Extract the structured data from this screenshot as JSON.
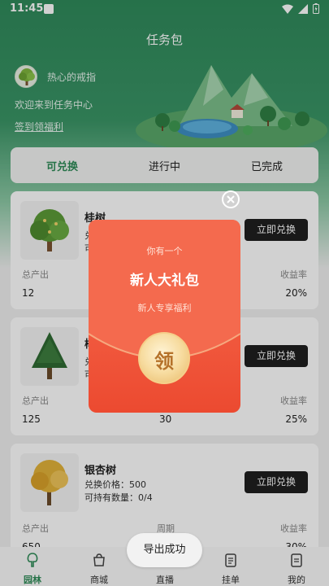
{
  "status_bar": {
    "time": "11:45"
  },
  "header": {
    "title": "任务包"
  },
  "user": {
    "name": "热心的戒指"
  },
  "welcome": {
    "text": "欢迎来到任务中心",
    "signin_link": "签到领福利"
  },
  "tabs": [
    {
      "label": "可兑换",
      "active": true
    },
    {
      "label": "进行中",
      "active": false
    },
    {
      "label": "已完成",
      "active": false
    }
  ],
  "cards": [
    {
      "name": "桂树",
      "line1": "兑",
      "line2": "可",
      "button": "立即兑换",
      "stat1_label": "总产出",
      "stat1_value": "12",
      "stat3_label": "收益率",
      "stat3_value": "20%"
    },
    {
      "name": "榉",
      "line1": "兑",
      "line2": "可",
      "button": "立即兑换",
      "stat1_label": "总产出",
      "stat1_value": "125",
      "stat2_value": "30",
      "stat3_label": "收益率",
      "stat3_value": "25%"
    },
    {
      "name": "银杏树",
      "line1": "兑换价格：500",
      "line2": "可持有数量：0/4",
      "button": "立即兑换",
      "stat1_label": "总产出",
      "stat1_value": "650",
      "stat2_label": "周期",
      "stat3_label": "收益率",
      "stat3_value": "30%"
    }
  ],
  "popup": {
    "subtitle": "你有一个",
    "title": "新人大礼包",
    "desc": "新人专享福利",
    "coin_label": "领",
    "colors": {
      "packet": "#f15a3f",
      "coin": "#f7dca0"
    }
  },
  "toast": {
    "text": "导出成功"
  },
  "nav": [
    {
      "label": "园林",
      "icon": "tree-icon",
      "active": true
    },
    {
      "label": "商城",
      "icon": "shop-icon",
      "active": false
    },
    {
      "label": "直播",
      "icon": "live-icon",
      "active": false
    },
    {
      "label": "挂单",
      "icon": "order-icon",
      "active": false
    },
    {
      "label": "我的",
      "icon": "profile-icon",
      "active": false
    }
  ],
  "colors": {
    "accent": "#2e8b57",
    "header_bg": "#3a9566",
    "button": "#1f1f1f"
  }
}
